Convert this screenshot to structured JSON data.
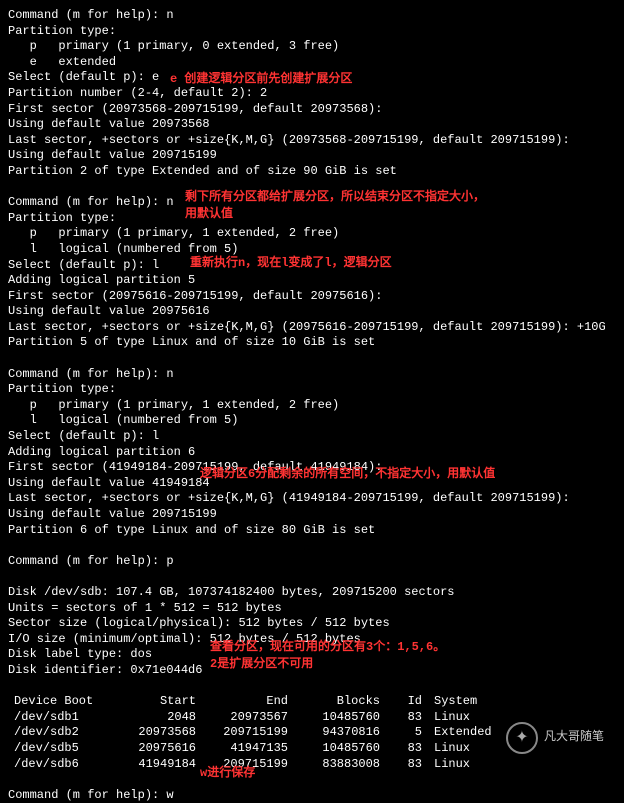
{
  "lines": {
    "l1": "Command (m for help): n",
    "l2": "Partition type:",
    "l3": "   p   primary (1 primary, 0 extended, 3 free)",
    "l4": "   e   extended",
    "l5": "Select (default p): e",
    "l6": "Partition number (2-4, default 2): 2",
    "l7": "First sector (20973568-209715199, default 20973568):",
    "l8": "Using default value 20973568",
    "l9": "Last sector, +sectors or +size{K,M,G} (20973568-209715199, default 209715199):",
    "l10": "Using default value 209715199",
    "l11": "Partition 2 of type Extended and of size 90 GiB is set",
    "l12": "Command (m for help): n",
    "l13": "Partition type:",
    "l14": "   p   primary (1 primary, 1 extended, 2 free)",
    "l15": "   l   logical (numbered from 5)",
    "l16": "Select (default p): l",
    "l17": "Adding logical partition 5",
    "l18": "First sector (20975616-209715199, default 20975616):",
    "l19": "Using default value 20975616",
    "l20": "Last sector, +sectors or +size{K,M,G} (20975616-209715199, default 209715199): +10G",
    "l21": "Partition 5 of type Linux and of size 10 GiB is set",
    "l22": "Command (m for help): n",
    "l23": "Partition type:",
    "l24": "   p   primary (1 primary, 1 extended, 2 free)",
    "l25": "   l   logical (numbered from 5)",
    "l26": "Select (default p): l",
    "l27": "Adding logical partition 6",
    "l28": "First sector (41949184-209715199, default 41949184):",
    "l29": "Using default value 41949184",
    "l30": "Last sector, +sectors or +size{K,M,G} (41949184-209715199, default 209715199):",
    "l31": "Using default value 209715199",
    "l32": "Partition 6 of type Linux and of size 80 GiB is set",
    "l33": "Command (m for help): p",
    "l34": "Disk /dev/sdb: 107.4 GB, 107374182400 bytes, 209715200 sectors",
    "l35": "Units = sectors of 1 * 512 = 512 bytes",
    "l36": "Sector size (logical/physical): 512 bytes / 512 bytes",
    "l37": "I/O size (minimum/optimal): 512 bytes / 512 bytes",
    "l38": "Disk label type: dos",
    "l39": "Disk identifier: 0x71e044d6",
    "l40": "Command (m for help): w"
  },
  "annot": {
    "a1": "e 创建逻辑分区前先创建扩展分区",
    "a2a": "剩下所有分区都给扩展分区，所以结束分区不指定大小，",
    "a2b": "用默认值",
    "a3": "重新执行n，现在l变成了l，逻辑分区",
    "a4": "逻辑分区6分配剩余的所有空间，不指定大小，用默认值",
    "a5a": "查看分区，现在可用的分区有3个：1,5,6。",
    "a5b": "2是扩展分区不可用",
    "a6": "w进行保存"
  },
  "table": {
    "headers": [
      "Device Boot",
      "Start",
      "End",
      "Blocks",
      "Id",
      "System"
    ],
    "rows": [
      {
        "dev": "/dev/sdb1",
        "start": "2048",
        "end": "20973567",
        "blocks": "10485760",
        "id": "83",
        "sys": "Linux"
      },
      {
        "dev": "/dev/sdb2",
        "start": "20973568",
        "end": "209715199",
        "blocks": "94370816",
        "id": "5",
        "sys": "Extended"
      },
      {
        "dev": "/dev/sdb5",
        "start": "20975616",
        "end": "41947135",
        "blocks": "10485760",
        "id": "83",
        "sys": "Linux"
      },
      {
        "dev": "/dev/sdb6",
        "start": "41949184",
        "end": "209715199",
        "blocks": "83883008",
        "id": "83",
        "sys": "Linux"
      }
    ]
  },
  "logo": "凡大哥随笔"
}
